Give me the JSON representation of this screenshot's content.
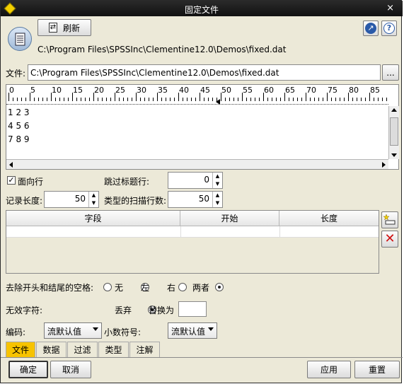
{
  "window": {
    "title": "固定文件",
    "close_glyph": "×"
  },
  "toolbar": {
    "refresh_label": "刷新",
    "path": "C:\\Program Files\\SPSSInc\\Clementine12.0\\Demos\\fixed.dat"
  },
  "file": {
    "label": "文件:",
    "value": "C:\\Program Files\\SPSSInc\\Clementine12.0\\Demos\\fixed.dat",
    "browse_label": "..."
  },
  "ruler": {
    "labels": [
      "0",
      "5",
      "10",
      "15",
      "20",
      "25",
      "30",
      "35",
      "40",
      "45",
      "50",
      "55",
      "60",
      "65",
      "70",
      "75",
      "80",
      "85"
    ]
  },
  "preview": {
    "lines": [
      "1 2 3",
      "4 5 6",
      "7 8 9"
    ]
  },
  "options": {
    "line_oriented_label": "面向行",
    "skip_header_label": "跳过标题行:",
    "skip_header_value": "0",
    "record_length_label": "记录长度:",
    "record_length_value": "50",
    "scan_rows_label": "类型的扫描行数:",
    "scan_rows_value": "50"
  },
  "fields_table": {
    "headers": [
      "字段",
      "开始",
      "长度"
    ]
  },
  "trim": {
    "label": "去除开头和结尾的空格:",
    "options": [
      "无",
      "左",
      "右",
      "两者"
    ],
    "selected": "两者"
  },
  "invalid": {
    "label": "无效字符:",
    "discard": "丢弃",
    "replace": "替换为"
  },
  "encoding": {
    "label": "编码:",
    "value": "流默认值",
    "decimal_label": "小数符号:",
    "decimal_value": "流默认值"
  },
  "tabs": [
    "文件",
    "数据",
    "过滤",
    "类型",
    "注解"
  ],
  "active_tab": "文件",
  "buttons": {
    "ok": "确定",
    "cancel": "取消",
    "apply": "应用",
    "reset": "重置"
  },
  "colors": {
    "active_tab": "#f7c300",
    "title_bar": "#1a1a1a",
    "delete_icon": "#d01010"
  },
  "icons": [
    "file-node-icon",
    "refresh-icon",
    "launch-icon",
    "help-icon",
    "add-field-icon",
    "delete-field-icon"
  ]
}
